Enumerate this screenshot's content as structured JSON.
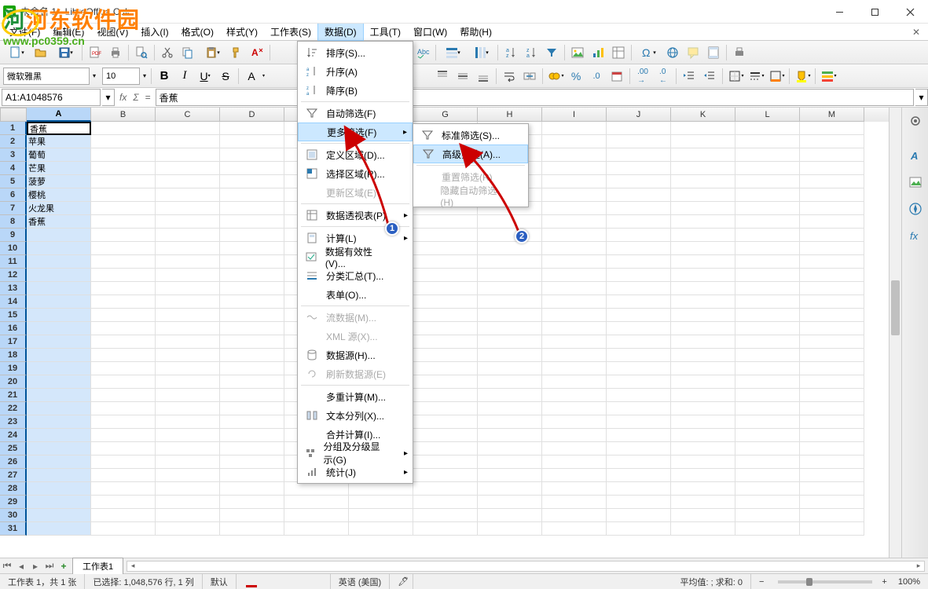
{
  "title": "未命名 1 - LibreOffice Calc",
  "watermark": {
    "text": "河东软件园",
    "url": "www.pc0359.cn"
  },
  "menubar": {
    "file": "文件(F)",
    "edit": "编辑(E)",
    "view": "视图(V)",
    "insert": "插入(I)",
    "format": "格式(O)",
    "styles": "样式(Y)",
    "sheet": "工作表(S)",
    "data": "数据(D)",
    "tools": "工具(T)",
    "window": "窗口(W)",
    "help": "帮助(H)"
  },
  "formatting": {
    "font": "微软雅黑",
    "size": "10"
  },
  "formula_bar": {
    "name_box": "A1:A1048576",
    "input": "香蕉"
  },
  "columns": [
    "A",
    "B",
    "C",
    "D",
    "E",
    "F",
    "G",
    "H",
    "I",
    "J",
    "K",
    "L",
    "M"
  ],
  "cells_A": [
    "香蕉",
    "苹果",
    "葡萄",
    "芒果",
    "菠萝",
    "樱桃",
    "火龙果",
    "香蕉"
  ],
  "sheet_tab": "工作表1",
  "data_menu": {
    "sort": "排序(S)...",
    "asc": "升序(A)",
    "desc": "降序(B)",
    "auto_filter": "自动筛选(F)",
    "more_filter": "更多筛选(F)",
    "define_range": "定义区域(D)...",
    "select_range": "选择区域(R)...",
    "refresh_range": "更新区域(E)",
    "pivot": "数据透视表(P)",
    "calc": "计算(L)",
    "validity": "数据有效性(V)...",
    "subtotals": "分类汇总(T)...",
    "form": "表单(O)...",
    "streams": "流数据(M)...",
    "xml_source": "XML 源(X)...",
    "data_source": "数据源(H)...",
    "refresh_data": "刷新数据源(E)",
    "multiple_ops": "多重计算(M)...",
    "text_to_cols": "文本分列(X)...",
    "consolidate": "合并计算(I)...",
    "group": "分组及分级显示(G)",
    "stats": "统计(J)"
  },
  "filter_submenu": {
    "standard": "标准筛选(S)...",
    "advanced": "高级筛选(A)...",
    "reset": "重置筛选(R)",
    "hide_auto": "隐藏自动筛选(H)"
  },
  "statusbar": {
    "sheet_count": "工作表 1，共 1 张",
    "selection": "已选择: 1,048,576 行, 1 列",
    "default": "默认",
    "lang": "英语 (美国)",
    "stats": "平均值: ; 求和: 0",
    "zoom": "100%"
  }
}
